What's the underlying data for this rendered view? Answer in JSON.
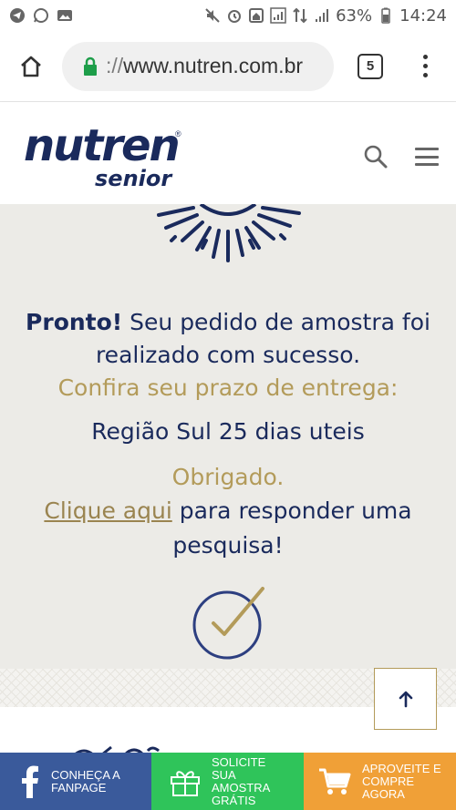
{
  "status_bar": {
    "battery": "63%",
    "time": "14:24"
  },
  "browser": {
    "url_scheme": "://",
    "url_host": "www.nutren.com.br",
    "tab_count": "5"
  },
  "header": {
    "logo_main": "nutren",
    "logo_sub": "senior",
    "logo_reg": "®"
  },
  "message": {
    "pronto": "Pronto!",
    "line1_rest": " Seu pedido de amostra foi",
    "line2": "realizado com sucesso.",
    "confira": "Confira seu prazo de entrega:",
    "regiao": "Região Sul 25 dias uteis",
    "obrigado": "Obrigado.",
    "link_text": "Clique aqui",
    "link_rest": " para responder uma",
    "last_line": "pesquisa!"
  },
  "bottom_bar": {
    "fanpage": [
      "CONHEÇA A",
      "FANPAGE"
    ],
    "amostra": [
      "SOLICITE",
      "SUA",
      "AMOSTRA",
      "GRÁTIS"
    ],
    "comprar": [
      "APROVEITE E",
      "COMPRE",
      "AGORA"
    ]
  },
  "colors": {
    "navy": "#1a2a5c",
    "gold": "#b39b5a",
    "facebook": "#3a5a9b",
    "green": "#2fc45a",
    "orange": "#f0a037"
  }
}
